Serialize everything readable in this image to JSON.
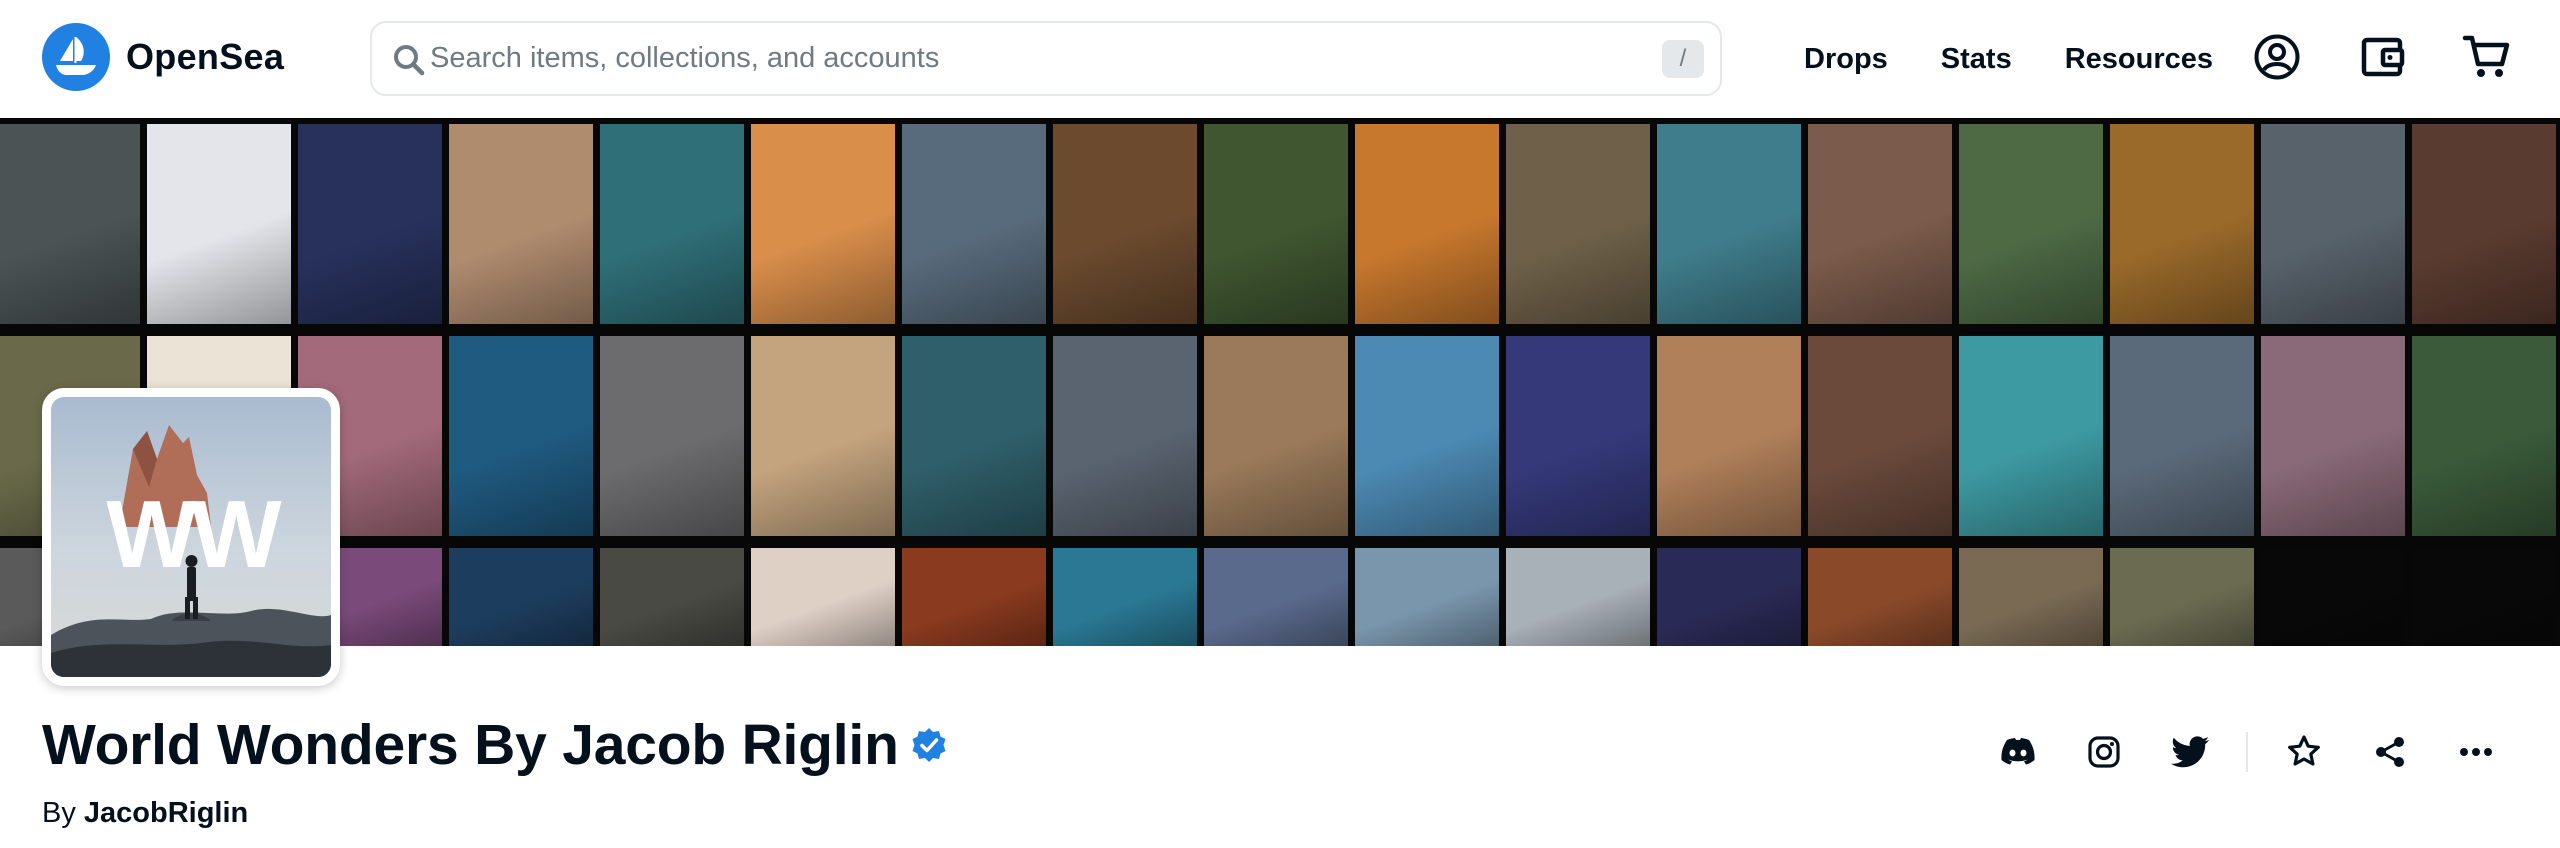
{
  "header": {
    "brand": "OpenSea",
    "search": {
      "placeholder": "Search items, collections, and accounts",
      "shortcut": "/"
    },
    "nav_links": [
      "Drops",
      "Stats",
      "Resources"
    ],
    "icons": [
      "account-icon",
      "wallet-icon",
      "cart-icon"
    ]
  },
  "banner": {
    "tile_colors": [
      [
        "#4b5355",
        "#e3e5ea",
        "#27315c",
        "#b08c6f",
        "#2f6f78",
        "#d98e4a",
        "#586b7c",
        "#6b4a2e",
        "#3f5630",
        "#c7782d",
        "#6f6149",
        "#3f7d8c",
        "#7b5b4b",
        "#4d6a45",
        "#9a6a2a",
        "#58626b",
        "#5a3b2f"
      ],
      [
        "#6a6a4a",
        "#ebe4d6",
        "#a36a7b",
        "#1f5a80",
        "#6c6c6e",
        "#c4a47e",
        "#2f5f6a",
        "#5a6470",
        "#9a7a5a",
        "#4c8ab4",
        "#35397a",
        "#b0805a",
        "#6b4a3c",
        "#3d9aa2",
        "#5b6a7a",
        "#8a6a78",
        "#3a5a3a"
      ],
      [
        "#5a5a5a",
        "#e8c89a",
        "#7a4a7a",
        "#1d3d5e",
        "#4a4a44",
        "#dfd0c6",
        "#8a3a1e",
        "#2a7894",
        "#5a6a8c",
        "#7a96ad",
        "#a8b0b8",
        "#2a2a56",
        "#8a4a2a",
        "#7a6a54",
        "#6b6b52",
        "#080808",
        "#080808"
      ]
    ]
  },
  "collection": {
    "avatar_text": "WW",
    "title": "World Wonders By Jacob Riglin",
    "by_prefix": "By",
    "creator": "JacobRiglin",
    "actions": [
      "discord-icon",
      "instagram-icon",
      "twitter-icon",
      "star-icon",
      "share-icon",
      "more-icon"
    ]
  },
  "colors": {
    "brand": "#2081e2",
    "text": "#04111d",
    "muted": "#707a83",
    "border": "#e5e8eb"
  }
}
